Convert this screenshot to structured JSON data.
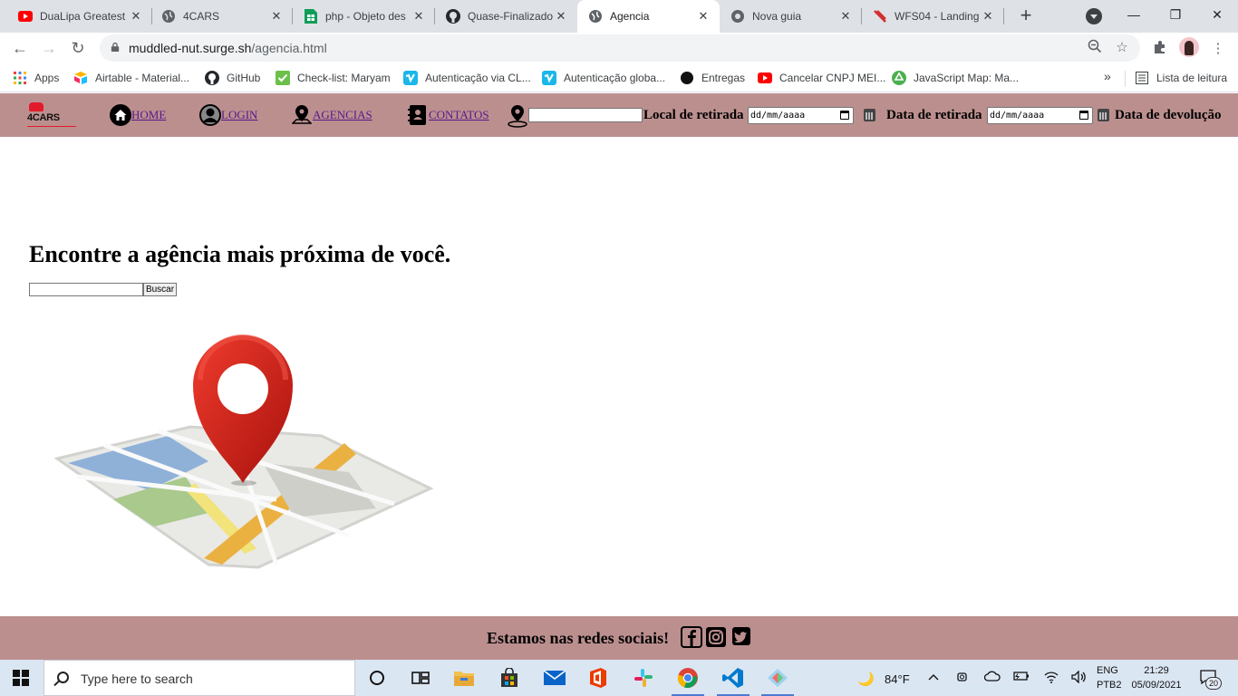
{
  "browser": {
    "tabs": [
      {
        "title": "DuaLipa Greatest",
        "favicon": "youtube-icon"
      },
      {
        "title": "4CARS",
        "favicon": "globe-icon"
      },
      {
        "title": "php - Objeto des",
        "favicon": "sheets-icon"
      },
      {
        "title": "Quase-Finalizado",
        "favicon": "github-icon"
      },
      {
        "title": "Agencia",
        "favicon": "globe-icon",
        "active": true
      },
      {
        "title": "Nova guia",
        "favicon": "chrome-icon"
      },
      {
        "title": "WFS04 - Landing",
        "favicon": "scissors-icon"
      }
    ],
    "close_glyph": "✕",
    "new_tab_glyph": "+",
    "window_controls": {
      "minimize": "—",
      "restore": "❐",
      "close": "✕"
    },
    "url_host": "muddled-nut.surge.sh",
    "url_path": "/agencia.html",
    "bookmarks": [
      {
        "label": "Apps",
        "icon": "apps-grid-icon"
      },
      {
        "label": "Airtable - Material...",
        "icon": "airtable-icon"
      },
      {
        "label": "GitHub",
        "icon": "github-icon"
      },
      {
        "label": "Check-list: Maryam",
        "icon": "checkmark-icon"
      },
      {
        "label": "Autenticação via CL...",
        "icon": "vimeo-icon"
      },
      {
        "label": "Autenticação globa...",
        "icon": "vimeo-icon"
      },
      {
        "label": "Entregas",
        "icon": "dot-icon"
      },
      {
        "label": "Cancelar CNPJ MEI...",
        "icon": "youtube-icon"
      },
      {
        "label": "JavaScript Map: Ma...",
        "icon": "recycle-icon"
      }
    ],
    "bookmarks_more": "»",
    "reading_list": "Lista de leitura"
  },
  "site": {
    "logo_text": "4CARS",
    "nav": {
      "home": "HOME",
      "login": "LOGIN",
      "agencias": "AGENCIAS",
      "contatos": "CONTATOS",
      "pickup_location_label": "Local de retirada",
      "pickup_date_label": "Data de retirada",
      "return_date_label": "Data de devolução",
      "date_placeholder": "dd/mm/aaaa"
    },
    "heading": "Encontre a agência mais próxima de você.",
    "search_button": "Buscar",
    "footer_text": "Estamos nas redes sociais!"
  },
  "taskbar": {
    "search_placeholder": "Type here to search",
    "weather": "84°F",
    "language_top": "ENG",
    "language_bottom": "PTB2",
    "time": "21:29",
    "date": "05/09/2021",
    "notifications": "20"
  },
  "colors": {
    "nav_bg": "#bc8f8f",
    "link": "#551a8b",
    "brand_red": "#e21b2b",
    "tab_strip": "#dee1e6",
    "taskbar": "#dbe6f3"
  }
}
